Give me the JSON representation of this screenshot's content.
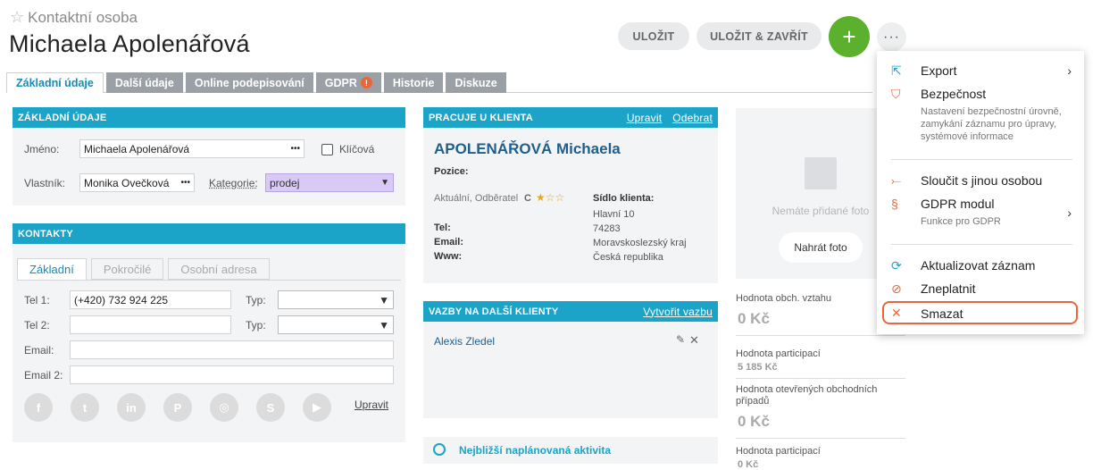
{
  "header": {
    "breadcrumb": "Kontaktní osoba",
    "title": "Michaela Apolenářová",
    "save_label": "ULOŽIT",
    "save_close_label": "ULOŽIT & ZAVŘÍT",
    "plus": "+",
    "more": "···"
  },
  "tabs": [
    {
      "label": "Základní údaje"
    },
    {
      "label": "Další údaje"
    },
    {
      "label": "Online podepisování"
    },
    {
      "label": "GDPR",
      "badge": "!"
    },
    {
      "label": "Historie"
    },
    {
      "label": "Diskuze"
    }
  ],
  "basic": {
    "header": "ZÁKLADNÍ ÚDAJE",
    "name_label": "Jméno:",
    "name_value": "Michaela Apolenářová",
    "key_label": "Klíčová",
    "owner_label": "Vlastník:",
    "owner_value": "Monika Ovečková",
    "category_label": "Kategorie:",
    "category_value": "prodej",
    "dots": "•••"
  },
  "contacts": {
    "header": "KONTAKTY",
    "subtabs": [
      "Základní",
      "Pokročilé",
      "Osobní adresa"
    ],
    "tel1_label": "Tel 1:",
    "tel1_value": "(+420) 732 924 225",
    "tel2_label": "Tel 2:",
    "type_label": "Typ:",
    "email_label": "Email:",
    "email2_label": "Email 2:",
    "edit_link": "Upravit",
    "socials": [
      "f",
      "t",
      "in",
      "P",
      "◎",
      "S",
      "▶"
    ]
  },
  "client": {
    "header": "PRACUJE U KLIENTA",
    "edit": "Upravit",
    "remove": "Odebrat",
    "name": "APOLENÁŘOVÁ Michaela",
    "position_label": "Pozice:",
    "status": "Aktuální, Odběratel",
    "rating_letter": "C",
    "stars": "★☆☆",
    "seat_label": "Sídlo klienta:",
    "address": [
      "Hlavní 10",
      "74283",
      "Moravskoslezský kraj",
      "Česká republika"
    ],
    "tel_label": "Tel:",
    "email_label": "Email:",
    "www_label": "Www:"
  },
  "relations": {
    "header": "VAZBY NA DALŠÍ KLIENTY",
    "create": "Vytvořit vazbu",
    "item": "Alexis Zledel"
  },
  "activity": {
    "label": "Nejbližší naplánovaná aktivita"
  },
  "photo": {
    "empty": "Nemáte přidané foto",
    "upload": "Nahrát foto"
  },
  "stats": [
    {
      "label": "Hodnota obch. vztahu",
      "value": "0 Kč"
    },
    {
      "label": "Hodnota participací",
      "value": "5 185 Kč"
    },
    {
      "label": "Hodnota otevřených obchodních případů",
      "value": "0 Kč"
    },
    {
      "label": "Hodnota participací",
      "value": "0 Kč"
    }
  ],
  "menu": {
    "export": "Export",
    "security": "Bezpečnost",
    "security_desc": "Nastavení bezpečnostní úrovně, zamykání záznamu pro úpravy, systémové informace",
    "merge": "Sloučit s jinou osobou",
    "gdpr": "GDPR modul",
    "gdpr_desc": "Funkce pro GDPR",
    "refresh": "Aktualizovat záznam",
    "invalidate": "Zneplatnit",
    "delete": "Smazat"
  },
  "colors": {
    "accent": "#1ca3c8",
    "green": "#5bb12e",
    "orange": "#e8673a",
    "category_bg": "#d9c9f5"
  }
}
